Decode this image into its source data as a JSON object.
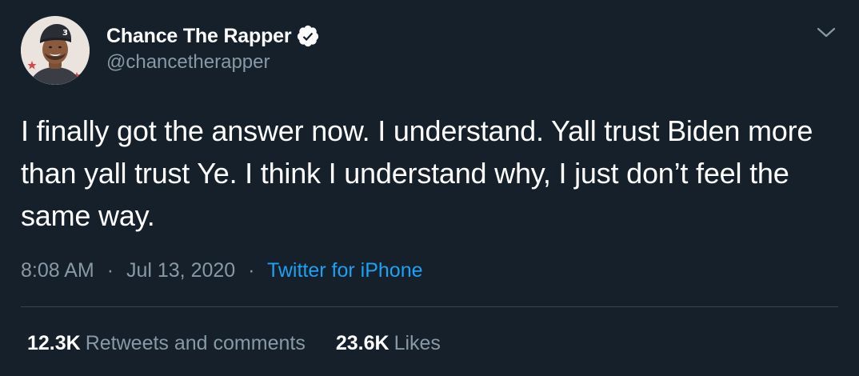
{
  "user": {
    "display_name": "Chance The Rapper",
    "handle": "@chancetherapper",
    "verified": true,
    "avatar_cap_number": "3"
  },
  "tweet": {
    "text": "I finally got the answer now. I understand. Yall trust Biden more than yall trust Ye. I think I understand why, I just don’t feel the same way.",
    "time": "8:08 AM",
    "date": "Jul 13, 2020",
    "separator": "·",
    "source": "Twitter for iPhone"
  },
  "stats": {
    "retweets_count": "12.3K",
    "retweets_label": "Retweets and comments",
    "likes_count": "23.6K",
    "likes_label": "Likes"
  },
  "icons": {
    "verified": "verified-badge-icon",
    "menu": "chevron-down-icon"
  },
  "colors": {
    "background": "#15202b",
    "primary_text": "#ffffff",
    "secondary_text": "#8899a6",
    "link": "#1da1f2",
    "divider": "#38444d"
  }
}
